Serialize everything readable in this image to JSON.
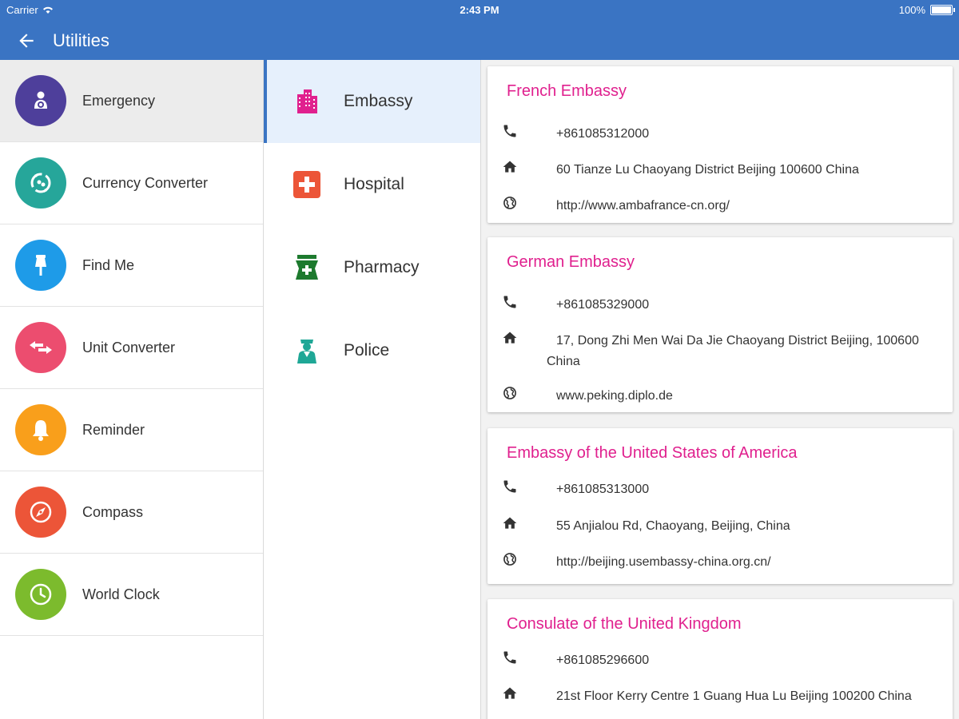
{
  "status_bar": {
    "carrier": "Carrier",
    "time": "2:43 PM",
    "battery": "100%"
  },
  "app_bar": {
    "title": "Utilities"
  },
  "categories": [
    {
      "label": "Emergency",
      "icon": "emergency-icon",
      "color": "#4e3f9b"
    },
    {
      "label": "Currency Converter",
      "icon": "currency-icon",
      "color": "#26a69a"
    },
    {
      "label": "Find Me",
      "icon": "pin-icon",
      "color": "#1e9be8"
    },
    {
      "label": "Unit Converter",
      "icon": "swap-arrows-icon",
      "color": "#ec4d6f"
    },
    {
      "label": "Reminder",
      "icon": "bell-icon",
      "color": "#f99f1b"
    },
    {
      "label": "Compass",
      "icon": "compass-icon",
      "color": "#ec5538"
    },
    {
      "label": "World Clock",
      "icon": "clock-icon",
      "color": "#7cbb2d"
    }
  ],
  "subcategories": [
    {
      "label": "Embassy",
      "icon": "building-icon",
      "color": "#e0208e"
    },
    {
      "label": "Hospital",
      "icon": "hospital-cross-icon",
      "color": "#ec5538"
    },
    {
      "label": "Pharmacy",
      "icon": "pharmacy-icon",
      "color": "#1d7a2e"
    },
    {
      "label": "Police",
      "icon": "police-icon",
      "color": "#1fa796"
    }
  ],
  "embassies": [
    {
      "name": "French Embassy",
      "phone": "+861085312000",
      "address": "60 Tianze Lu Chaoyang District Beijing 100600 China",
      "website": "http://www.ambafrance-cn.org/"
    },
    {
      "name": "German Embassy",
      "phone": "+861085329000",
      "address": "17, Dong Zhi Men Wai Da Jie Chaoyang District Beijing, 100600 China",
      "website": "www.peking.diplo.de"
    },
    {
      "name": "Embassy of the United States of America",
      "phone": "+861085313000",
      "address": "55 Anjialou Rd, Chaoyang,  Beijing, China",
      "website": "http://beijing.usembassy-china.org.cn/"
    },
    {
      "name": "Consulate of the United Kingdom",
      "phone": "+861085296600",
      "address": "21st Floor Kerry Centre 1 Guang Hua Lu Beijing 100200 China"
    }
  ],
  "colors": {
    "primary": "#3a74c3",
    "accent": "#e0208e"
  }
}
